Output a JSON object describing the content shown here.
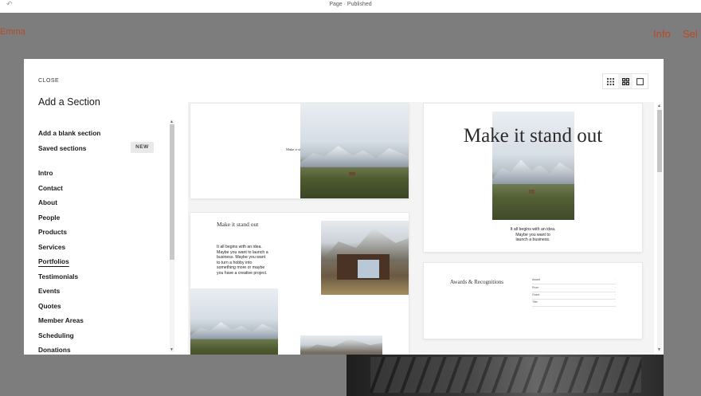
{
  "topbar": {
    "undo_icon": "undo-icon",
    "status": "Page · Published"
  },
  "site": {
    "brand": "Emma",
    "nav": [
      "Info",
      "Sel"
    ]
  },
  "modal": {
    "close_label": "CLOSE",
    "title": "Add a Section",
    "view_toggle": [
      "grid-small-icon",
      "grid-large-icon",
      "single-view-icon"
    ],
    "top_items": [
      {
        "label": "Add a blank section"
      },
      {
        "label": "Saved sections",
        "badge": "NEW"
      }
    ],
    "categories": [
      "Intro",
      "Contact",
      "About",
      "People",
      "Products",
      "Services",
      "Portfolios",
      "Testimonials",
      "Events",
      "Quotes",
      "Member Areas",
      "Scheduling",
      "Donations"
    ],
    "active_category": "Portfolios"
  },
  "previews": {
    "card1": {
      "caption": "Make it stand out"
    },
    "card2": {
      "heading": "Make it stand out",
      "body": [
        "It all begins with an idea.",
        "Maybe you want to launch a",
        "business. Maybe you want",
        "to turn a hobby into",
        "something more or maybe",
        "you have a creative project."
      ]
    },
    "card3": {
      "heading": "Make it stand out",
      "body": [
        "It all begins with an idea.",
        "Maybe you want to",
        "launch a business."
      ]
    },
    "card4": {
      "heading": "Awards & Recognitions",
      "rows": [
        [
          "Award",
          "·"
        ],
        [
          "Prize",
          "·"
        ],
        [
          "Grant",
          "·"
        ],
        [
          "Title",
          "·"
        ]
      ]
    }
  }
}
